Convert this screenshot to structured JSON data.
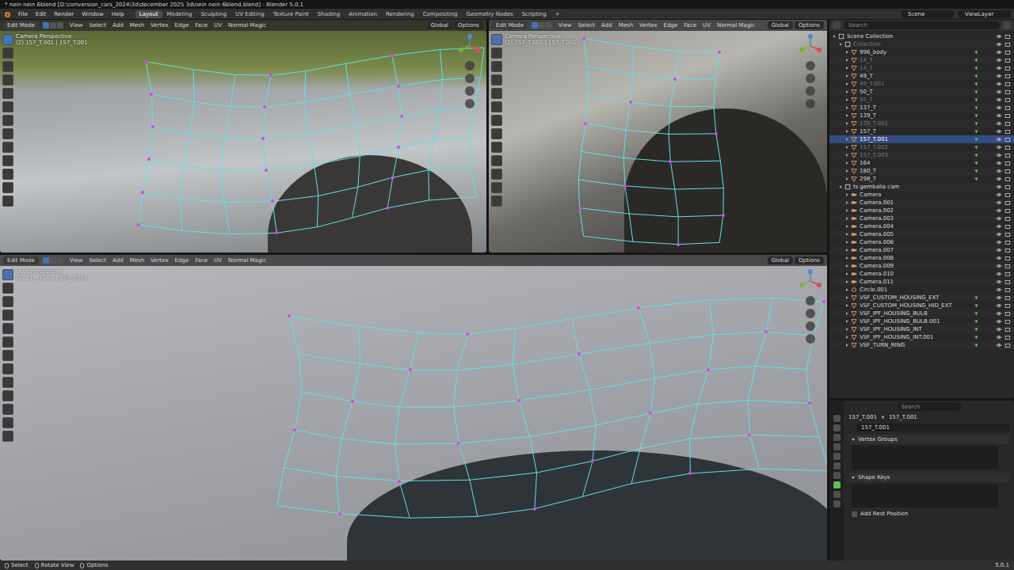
{
  "window": {
    "title": "* nein nein 6blend [D:\\conversion_cars_2024\\3d\\december 2025 3d\\nein nein 6blend.blend] - Blender 5.0.1"
  },
  "menu": [
    "File",
    "Edit",
    "Render",
    "Window",
    "Help"
  ],
  "workspaces": [
    {
      "label": "Layout",
      "selected": true
    },
    {
      "label": "Modeling",
      "selected": false
    },
    {
      "label": "Sculpting",
      "selected": false
    },
    {
      "label": "UV Editing",
      "selected": false
    },
    {
      "label": "Texture Paint",
      "selected": false
    },
    {
      "label": "Shading",
      "selected": false
    },
    {
      "label": "Animation",
      "selected": false
    },
    {
      "label": "Rendering",
      "selected": false
    },
    {
      "label": "Compositing",
      "selected": false
    },
    {
      "label": "Geometry Nodes",
      "selected": false
    },
    {
      "label": "Scripting",
      "selected": false
    }
  ],
  "add_workspace": "+",
  "scene": "Scene",
  "view_layer": "ViewLayer",
  "toolbar": [
    {
      "selected": true
    },
    {
      "selected": false
    },
    {
      "selected": false
    },
    {
      "selected": false
    },
    {
      "selected": false
    },
    {
      "selected": false
    },
    {
      "selected": false
    },
    {
      "selected": false
    },
    {
      "selected": false
    },
    {
      "selected": false
    },
    {
      "selected": false
    },
    {
      "selected": false
    },
    {
      "selected": false
    }
  ],
  "viewports": [
    {
      "kind": "photo-foliage",
      "mode": "Edit Mode",
      "menus": [
        "View",
        "Select",
        "Add",
        "Mesh",
        "Vertex",
        "Edge",
        "Face",
        "UV",
        "Normal Magic"
      ],
      "orientation": "Global",
      "options": "Options",
      "view": "Camera Perspective",
      "object": "(2) 157_T.001 | 157_T.001"
    },
    {
      "kind": "photo-arch",
      "mode": "Edit Mode",
      "menus": [
        "View",
        "Select",
        "Add",
        "Mesh",
        "Vertex",
        "Edge",
        "Face",
        "UV",
        "Normal Magic"
      ],
      "orientation": "Global",
      "options": "Options",
      "view": "Camera Perspective",
      "object": "(2) 157_T.001 | 157_T.001"
    },
    {
      "kind": "render",
      "mode": "Edit Mode",
      "menus": [
        "View",
        "Select",
        "Add",
        "Mesh",
        "Vertex",
        "Edge",
        "Face",
        "UV",
        "Normal Magic"
      ],
      "orientation": "Global",
      "options": "Options",
      "view": "User Perspective",
      "object": "(2) 157_T.001 | 157_T.001"
    }
  ],
  "outliner": {
    "search": "Search",
    "items": [
      {
        "label": "Scene Collection",
        "depth": 0,
        "kind": "scene",
        "selected": false,
        "greyed": false
      },
      {
        "label": "Collection",
        "depth": 1,
        "kind": "collection",
        "selected": false,
        "greyed": true
      },
      {
        "label": "996_body",
        "depth": 2,
        "kind": "mesh",
        "selected": false,
        "greyed": false
      },
      {
        "label": "14_T",
        "depth": 2,
        "kind": "mesh",
        "selected": false,
        "greyed": true
      },
      {
        "label": "14_T",
        "depth": 2,
        "kind": "mesh",
        "selected": false,
        "greyed": true
      },
      {
        "label": "49_T",
        "depth": 2,
        "kind": "mesh",
        "selected": false,
        "greyed": false
      },
      {
        "label": "49_T.001",
        "depth": 2,
        "kind": "mesh",
        "selected": false,
        "greyed": true
      },
      {
        "label": "50_T",
        "depth": 2,
        "kind": "mesh",
        "selected": false,
        "greyed": false
      },
      {
        "label": "55_T",
        "depth": 2,
        "kind": "mesh",
        "selected": false,
        "greyed": true
      },
      {
        "label": "137_T",
        "depth": 2,
        "kind": "mesh",
        "selected": false,
        "greyed": false
      },
      {
        "label": "139_T",
        "depth": 2,
        "kind": "mesh",
        "selected": false,
        "greyed": false
      },
      {
        "label": "139_T.001",
        "depth": 2,
        "kind": "mesh",
        "selected": false,
        "greyed": true
      },
      {
        "label": "157_T",
        "depth": 2,
        "kind": "mesh",
        "selected": false,
        "greyed": false
      },
      {
        "label": "157_T.001",
        "depth": 2,
        "kind": "mesh",
        "selected": true,
        "greyed": false
      },
      {
        "label": "157_T.002",
        "depth": 2,
        "kind": "mesh",
        "selected": false,
        "greyed": true
      },
      {
        "label": "157_T.003",
        "depth": 2,
        "kind": "mesh",
        "selected": false,
        "greyed": true
      },
      {
        "label": "164",
        "depth": 2,
        "kind": "mesh",
        "selected": false,
        "greyed": false
      },
      {
        "label": "180_T",
        "depth": 2,
        "kind": "mesh",
        "selected": false,
        "greyed": false
      },
      {
        "label": "298_T",
        "depth": 2,
        "kind": "mesh",
        "selected": false,
        "greyed": false
      },
      {
        "label": "ts gembalia cam",
        "depth": 1,
        "kind": "collection",
        "selected": false,
        "greyed": false
      },
      {
        "label": "Camera",
        "depth": 2,
        "kind": "camera",
        "selected": false,
        "greyed": false
      },
      {
        "label": "Camera.001",
        "depth": 2,
        "kind": "camera",
        "selected": false,
        "greyed": false
      },
      {
        "label": "Camera.002",
        "depth": 2,
        "kind": "camera",
        "selected": false,
        "greyed": false
      },
      {
        "label": "Camera.003",
        "depth": 2,
        "kind": "camera",
        "selected": false,
        "greyed": false
      },
      {
        "label": "Camera.004",
        "depth": 2,
        "kind": "camera",
        "selected": false,
        "greyed": false
      },
      {
        "label": "Camera.005",
        "depth": 2,
        "kind": "camera",
        "selected": false,
        "greyed": false
      },
      {
        "label": "Camera.006",
        "depth": 2,
        "kind": "camera",
        "selected": false,
        "greyed": false
      },
      {
        "label": "Camera.007",
        "depth": 2,
        "kind": "camera",
        "selected": false,
        "greyed": false
      },
      {
        "label": "Camera.008",
        "depth": 2,
        "kind": "camera",
        "selected": false,
        "greyed": false
      },
      {
        "label": "Camera.009",
        "depth": 2,
        "kind": "camera",
        "selected": false,
        "greyed": false
      },
      {
        "label": "Camera.010",
        "depth": 2,
        "kind": "camera",
        "selected": false,
        "greyed": false
      },
      {
        "label": "Camera.011",
        "depth": 2,
        "kind": "camera",
        "selected": false,
        "greyed": false
      },
      {
        "label": "Circle.001",
        "depth": 2,
        "kind": "curve",
        "selected": false,
        "greyed": false
      },
      {
        "label": "VSF_CUSTOM_HOUSING_EXT",
        "depth": 2,
        "kind": "mesh",
        "selected": false,
        "greyed": false
      },
      {
        "label": "VSF_CUSTOM_HOUSING_HID_EXT",
        "depth": 2,
        "kind": "mesh",
        "selected": false,
        "greyed": false
      },
      {
        "label": "VSF_IPF_HOUSING_BULB",
        "depth": 2,
        "kind": "mesh",
        "selected": false,
        "greyed": false
      },
      {
        "label": "VSF_IPF_HOUSING_BULB.001",
        "depth": 2,
        "kind": "mesh",
        "selected": false,
        "greyed": false
      },
      {
        "label": "VSF_IPF_HOUSING_INT",
        "depth": 2,
        "kind": "mesh",
        "selected": false,
        "greyed": false
      },
      {
        "label": "VSF_IPF_HOUSING_INT.001",
        "depth": 2,
        "kind": "mesh",
        "selected": false,
        "greyed": false
      },
      {
        "label": "VSF_TURN_RING",
        "depth": 2,
        "kind": "mesh",
        "selected": false,
        "greyed": false
      }
    ]
  },
  "properties": {
    "search": "Search",
    "object": "157_T.001",
    "data": "157_T.001",
    "mesh": "157_T.001",
    "sections": [
      {
        "label": "Vertex Groups",
        "expanded": true
      },
      {
        "label": "Shape Keys",
        "expanded": true
      }
    ],
    "checkbox": {
      "label": "Add Rest Position",
      "checked": false
    }
  },
  "status_bar": {
    "hints": [
      "Select",
      "Rotate View",
      "Options"
    ],
    "version": "5.0.1"
  }
}
